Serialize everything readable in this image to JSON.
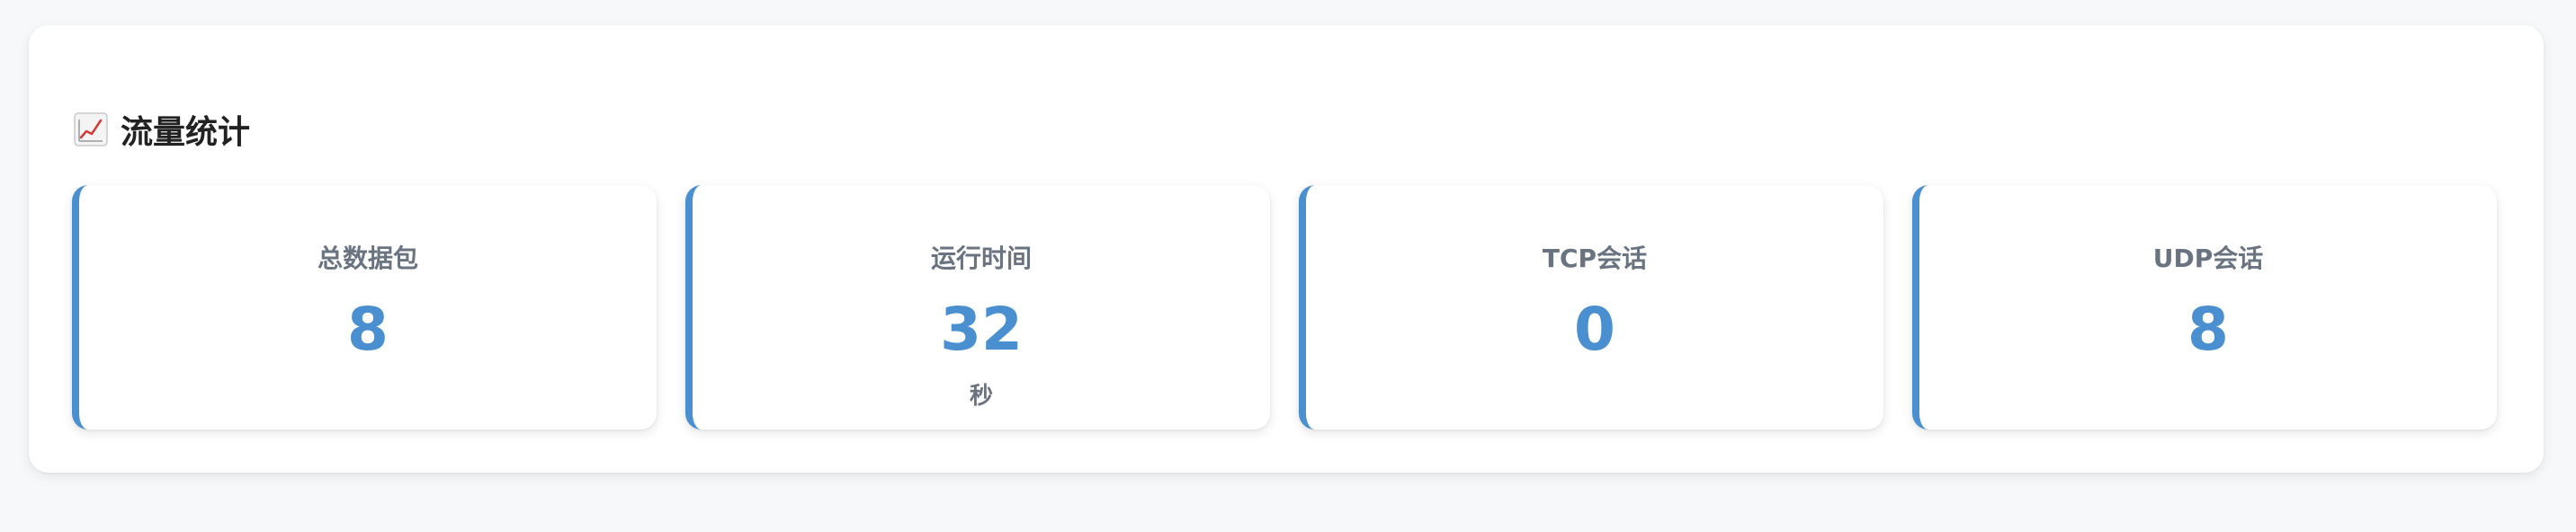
{
  "section": {
    "title": "流量统计",
    "icon": "chart-increasing-icon"
  },
  "colors": {
    "accent": "#4a90d0",
    "label": "#6a7380",
    "title": "#222222",
    "page_bg": "#f7f8fa"
  },
  "stats": [
    {
      "label": "总数据包",
      "value": "8",
      "unit": ""
    },
    {
      "label": "运行时间",
      "value": "32",
      "unit": "秒"
    },
    {
      "label": "TCP会话",
      "value": "0",
      "unit": ""
    },
    {
      "label": "UDP会话",
      "value": "8",
      "unit": ""
    }
  ]
}
